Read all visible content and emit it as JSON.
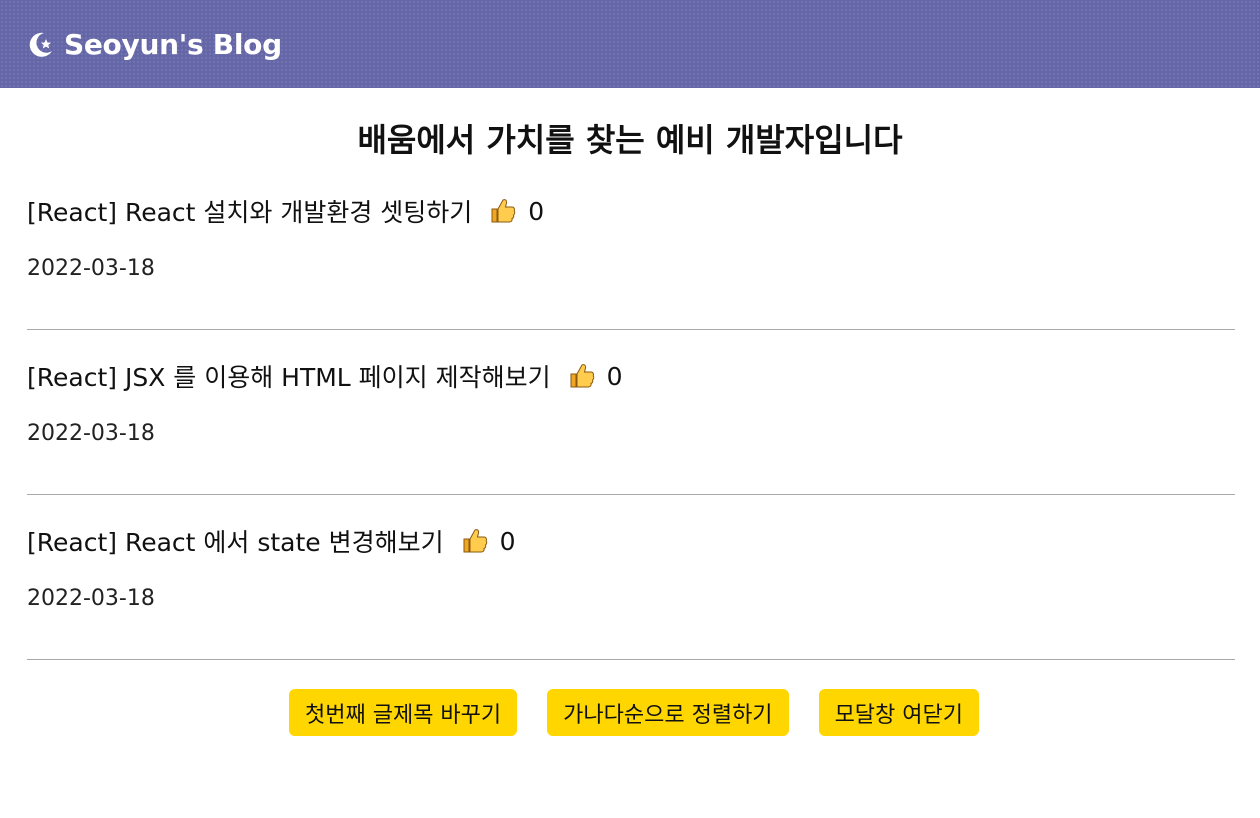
{
  "nav": {
    "logo_icon": "moon-star-icon",
    "title": "Seoyun's Blog"
  },
  "headline": "배움에서 가치를 찾는 예비 개발자입니다",
  "posts": [
    {
      "title": "[React] React 설치와 개발환경 셋팅하기",
      "likes": "0",
      "date": "2022-03-18"
    },
    {
      "title": "[React] JSX 를 이용해 HTML 페이지 제작해보기",
      "likes": "0",
      "date": "2022-03-18"
    },
    {
      "title": "[React] React 에서 state 변경해보기",
      "likes": "0",
      "date": "2022-03-18"
    }
  ],
  "like_icon": "thumbs-up-icon",
  "actions": {
    "change_first_title": "첫번째 글제목 바꾸기",
    "sort_alphabetical": "가나다순으로 정렬하기",
    "toggle_modal": "모달창 여닫기"
  },
  "colors": {
    "nav_background": "#6466a8",
    "button_background": "#ffd600",
    "divider": "#a9a9a9"
  }
}
